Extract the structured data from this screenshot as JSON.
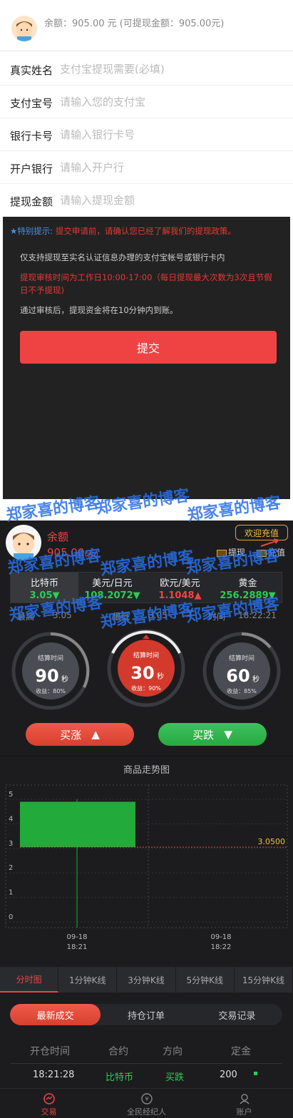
{
  "balance_line": "余额：905.00 元 (可提现金额：905.00元)",
  "form": {
    "rows": [
      {
        "label": "真实姓名",
        "placeholder": "支付宝提现需要(必填)"
      },
      {
        "label": "支付宝号",
        "placeholder": "请输入您的支付宝"
      },
      {
        "label": "银行卡号",
        "placeholder": "请输入银行卡号"
      },
      {
        "label": "开户银行",
        "placeholder": "请输入开户行"
      },
      {
        "label": "提现金额",
        "placeholder": "请输入提现金额"
      }
    ]
  },
  "notice": {
    "prefix": "★特别提示:",
    "headline": "提交申请前，请确认您已经了解我们的提现政策。",
    "line1": "仅支持提现至实名认证信息办理的支付宝帐号或银行卡内",
    "line2": "提现审核时间为工作日10:00-17:00（每日提现最大次数为3次且节假日不予提现)",
    "line3": "通过审核后，提现资金将在10分钟内到账。",
    "submit_label": "提交"
  },
  "watermark": "郑家喜的博客",
  "account": {
    "balance_label": "余额",
    "balance_value": "905.00",
    "balance_unit": "(元)",
    "welcome_label": "欢迎充值",
    "withdraw_label": "提现",
    "recharge_label": "充值"
  },
  "tickers": [
    {
      "name": "比特币",
      "price": "3.05",
      "dir": "▼",
      "color": "#2ecc55"
    },
    {
      "name": "美元/日元",
      "price": "108.2072",
      "dir": "▼",
      "color": "#2ecc55"
    },
    {
      "name": "欧元/美元",
      "price": "1.1048",
      "dir": "▲",
      "color": "#ef4343"
    },
    {
      "name": "黄金",
      "price": "256.2889",
      "dir": "▼",
      "color": "#2ecc55"
    }
  ],
  "stats": {
    "high_label": "最高",
    "high_value": "3.05",
    "low_label": "最低",
    "low_value": "3.05",
    "time_label": "时间",
    "time_value": "18:22:21"
  },
  "dials": [
    {
      "label": "结算时间",
      "seconds": "90",
      "unit": "秒",
      "yield": "收益：80%",
      "active": false
    },
    {
      "label": "结算时间",
      "seconds": "30",
      "unit": "秒",
      "yield": "收益：90%",
      "active": true
    },
    {
      "label": "结算时间",
      "seconds": "60",
      "unit": "秒",
      "yield": "收益：85%",
      "active": false
    }
  ],
  "buy_up_label": "买涨",
  "buy_down_label": "买跌",
  "chart_data": {
    "type": "bar",
    "title": "商品走势图",
    "x": [
      "09-18 18:21",
      "09-18 18:22"
    ],
    "categories": [
      "09-18\n18:21",
      "09-18\n18:22"
    ],
    "bars": [
      {
        "x": "09-18 18:21",
        "open": 3.05,
        "close": 4.9,
        "low": 0,
        "high": 5
      }
    ],
    "current_price": "3.0500",
    "current_value": 3.05,
    "ylim": [
      0,
      5
    ],
    "yticks": [
      "0",
      "1",
      "2",
      "3",
      "4",
      "5"
    ],
    "grid": true,
    "xlabel": "",
    "ylabel": ""
  },
  "period_tabs": [
    "分时图",
    "1分钟K线",
    "3分钟K线",
    "5分钟K线",
    "15分钟K线"
  ],
  "segment_tabs": [
    "最新成交",
    "持仓订单",
    "交易记录"
  ],
  "table": {
    "headers": [
      "开仓时间",
      "合约",
      "方向",
      "定金"
    ],
    "rows": [
      {
        "time": "18:21:28",
        "contract": "比特币",
        "direction": "买跌",
        "deposit": "200"
      }
    ]
  },
  "bottom_nav": [
    {
      "label": "交易",
      "icon": "trade-icon"
    },
    {
      "label": "全民经纪人",
      "icon": "broker-icon"
    },
    {
      "label": "账户",
      "icon": "account-icon"
    }
  ],
  "colors": {
    "red": "#ef4343",
    "green": "#2ecc55",
    "dark_bg": "#1c1c1e",
    "gold": "#f0c040"
  }
}
